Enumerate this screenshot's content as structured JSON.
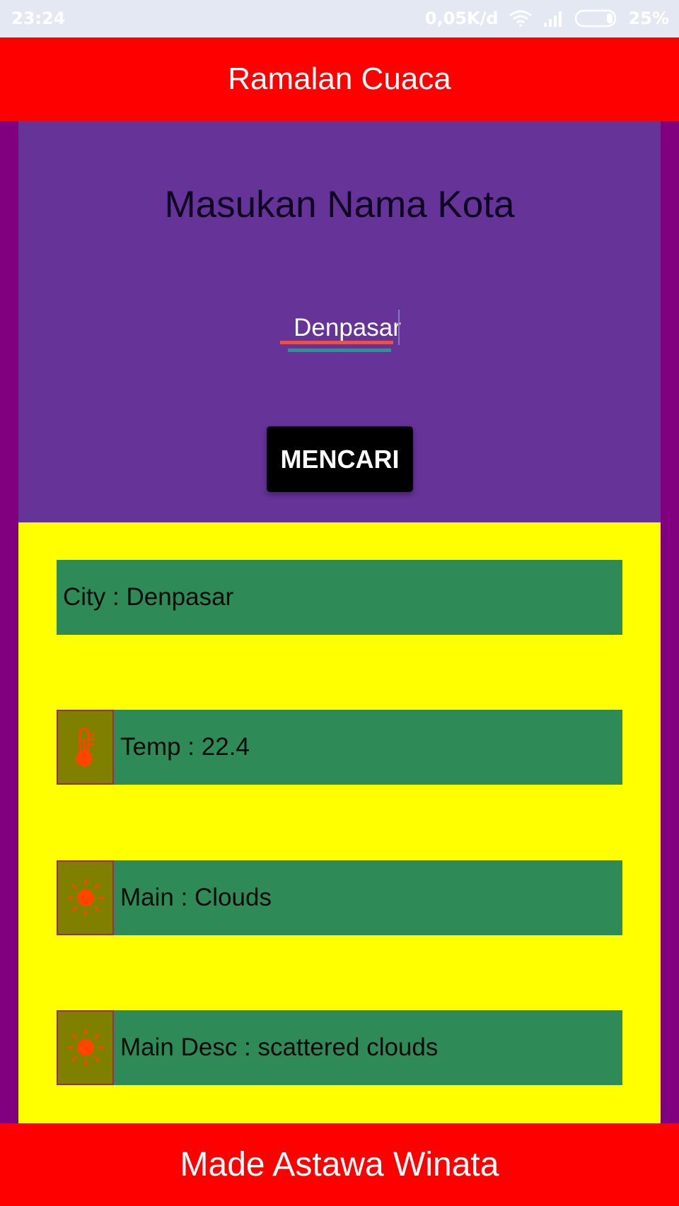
{
  "status_bar": {
    "time": "23:24",
    "network_speed": "0,05K/d",
    "battery": "25%",
    "icons": [
      "wifi-icon",
      "signal-icon",
      "battery-icon"
    ]
  },
  "app_bar": {
    "title": "Ramalan Cuaca"
  },
  "search": {
    "title": "Masukan Nama Kota",
    "input_value": "Denpasar",
    "button_label": "MENCARI"
  },
  "results": {
    "city": "City : Denpasar",
    "temp": "Temp : 22.4",
    "main": "Main : Clouds",
    "desc": "Main Desc : scattered clouds",
    "icons": [
      "thermometer-icon",
      "sun-icon",
      "sun-icon"
    ]
  },
  "footer": {
    "text": "Made Astawa Winata"
  },
  "colors": {
    "app_bar": "#ff0000",
    "search_panel": "#663399",
    "results_panel": "#ffff00",
    "row": "#2e8b57",
    "icon_box": "#808000",
    "icon": "#ff4500",
    "background": "#800080"
  }
}
